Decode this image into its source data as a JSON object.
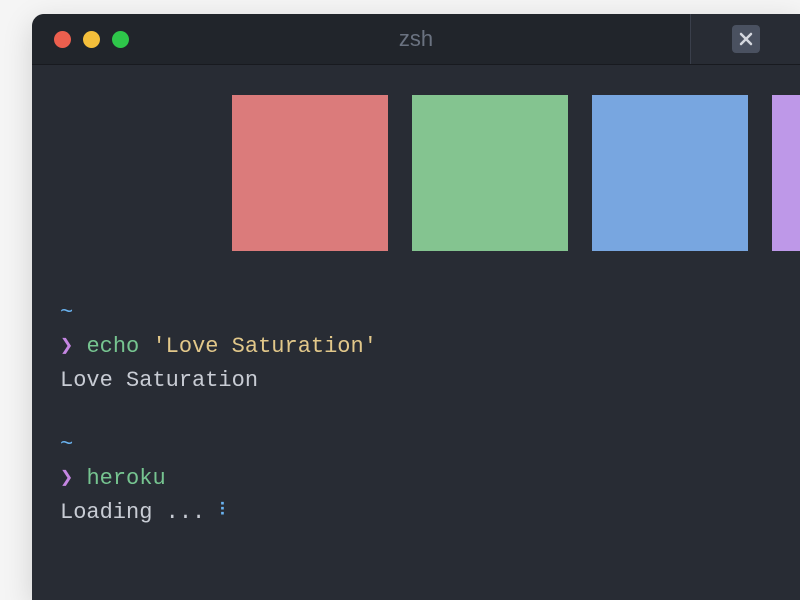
{
  "window": {
    "title": "zsh"
  },
  "swatches": [
    {
      "color": "#db7b7b"
    },
    {
      "color": "#84c490"
    },
    {
      "color": "#78a6e0"
    },
    {
      "color": "#be98e8"
    }
  ],
  "terminal": {
    "blocks": [
      {
        "cwd": "~",
        "prompt": "❯",
        "command_name": "echo",
        "command_rest": "'Love Saturation'",
        "output": "Love Saturation"
      },
      {
        "cwd": "~",
        "prompt": "❯",
        "command_name": "heroku",
        "command_rest": "",
        "output": "Loading ...",
        "spinner": "⠇"
      }
    ]
  }
}
